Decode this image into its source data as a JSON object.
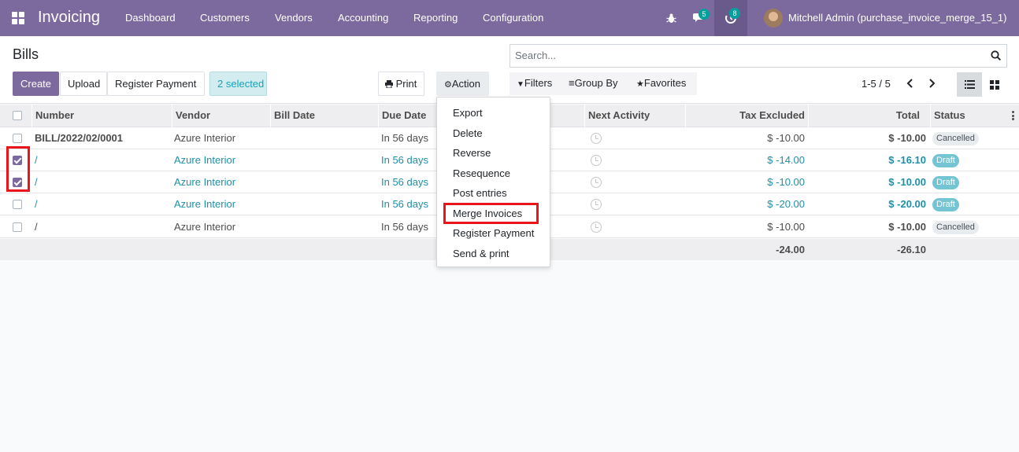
{
  "navbar": {
    "app_name": "Invoicing",
    "menu": [
      "Dashboard",
      "Customers",
      "Vendors",
      "Accounting",
      "Reporting",
      "Configuration"
    ],
    "messages_count": "5",
    "activities_count": "8",
    "user": "Mitchell Admin (purchase_invoice_merge_15_1)",
    "bg_color": "#7c6a9e"
  },
  "control_panel": {
    "title": "Bills",
    "create": "Create",
    "upload": "Upload",
    "register_payment": "Register Payment",
    "selected": "2 selected",
    "print": "Print",
    "action": "Action",
    "search_placeholder": "Search...",
    "filters": "Filters",
    "group_by": "Group By",
    "favorites": "Favorites",
    "pager": "1-5 / 5"
  },
  "table": {
    "headers": {
      "number": "Number",
      "vendor": "Vendor",
      "bill_date": "Bill Date",
      "due_date": "Due Date",
      "next_activity": "Next Activity",
      "tax_excluded": "Tax Excluded",
      "total": "Total",
      "status": "Status"
    },
    "rows": [
      {
        "number": "BILL/2022/02/0001",
        "vendor": "Azure Interior",
        "bill_date": "",
        "due_date": "In 56 days",
        "tax_excluded": "$ -10.00",
        "total": "$ -10.00",
        "status": "Cancelled",
        "checked": false
      },
      {
        "number": "/",
        "vendor": "Azure Interior",
        "bill_date": "",
        "due_date": "In 56 days",
        "tax_excluded": "$ -14.00",
        "total": "$ -16.10",
        "status": "Draft",
        "checked": true
      },
      {
        "number": "/",
        "vendor": "Azure Interior",
        "bill_date": "",
        "due_date": "In 56 days",
        "tax_excluded": "$ -10.00",
        "total": "$ -10.00",
        "status": "Draft",
        "checked": true
      },
      {
        "number": "/",
        "vendor": "Azure Interior",
        "bill_date": "",
        "due_date": "In 56 days",
        "tax_excluded": "$ -20.00",
        "total": "$ -20.00",
        "status": "Draft",
        "checked": false
      },
      {
        "number": "/",
        "vendor": "Azure Interior",
        "bill_date": "",
        "due_date": "In 56 days",
        "tax_excluded": "$ -10.00",
        "total": "$ -10.00",
        "status": "Cancelled",
        "checked": false
      }
    ],
    "footer": {
      "tax_excluded": "-24.00",
      "total": "-26.10"
    }
  },
  "action_menu": {
    "items": [
      "Export",
      "Delete",
      "Reverse",
      "Resequence",
      "Post entries",
      "Merge Invoices",
      "Register Payment",
      "Send & print"
    ],
    "highlighted": "Merge Invoices"
  },
  "colors": {
    "primary": "#7c6a9e",
    "draft_text": "#1f8fa8",
    "highlight_box": "#e8151b",
    "badge": "#00a09d"
  }
}
